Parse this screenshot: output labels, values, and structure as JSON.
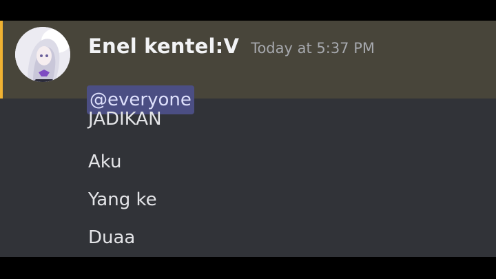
{
  "message": {
    "author": "Enel kentel:V",
    "timestamp": "Today at 5:37 PM",
    "mention": "@everyone",
    "lines": [
      "JADIKAN",
      "Aku",
      "Yang ke",
      "Duaa"
    ]
  },
  "colors": {
    "chat_background": "#313338",
    "mention_highlight_background": "#48453a",
    "mention_bar": "#f0b232",
    "mention_chip": "#4b4e83",
    "mention_text": "#dee0fc",
    "author_name": "#f2f3f5",
    "timestamp": "#a6a8ad",
    "message_text": "#e4e5e8"
  },
  "icons": {
    "avatar": "user-avatar"
  }
}
